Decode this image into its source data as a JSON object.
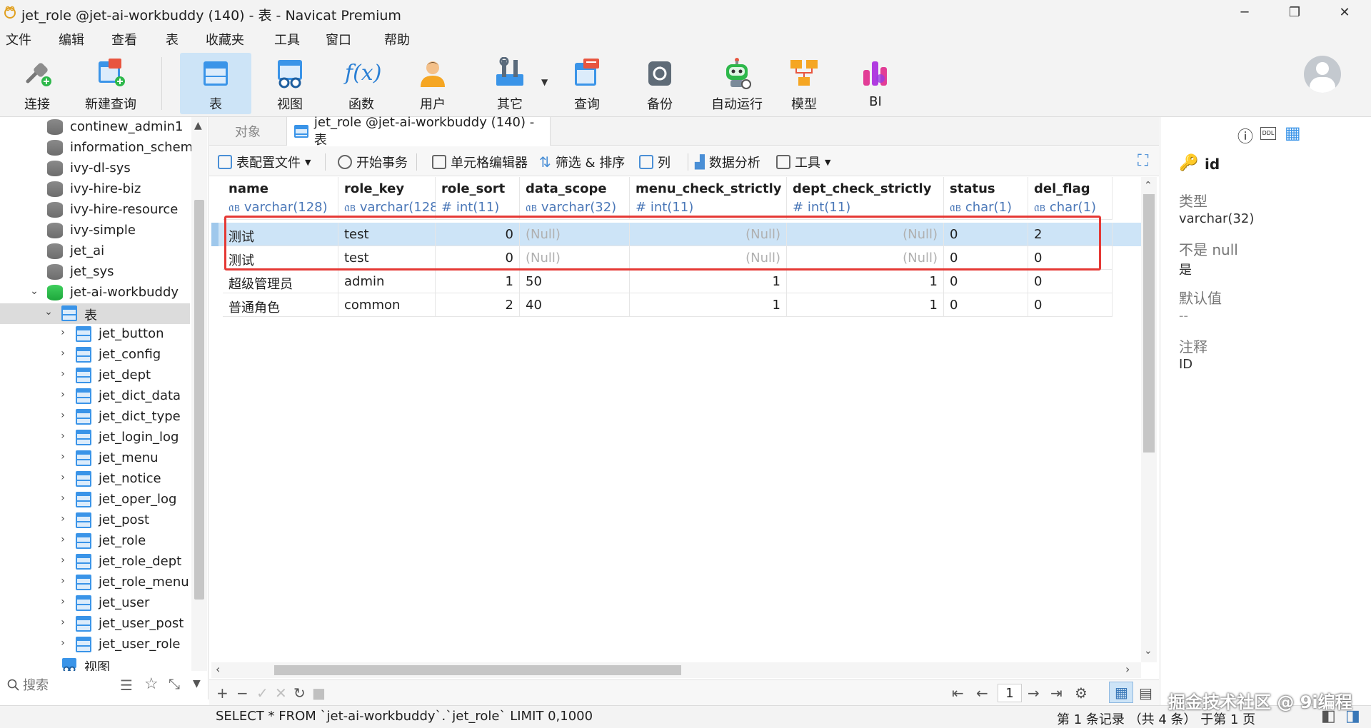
{
  "window": {
    "title": "jet_role @jet-ai-workbuddy (140) - 表 - Navicat Premium",
    "minimize": "─",
    "restore": "❐",
    "close": "✕"
  },
  "menu": [
    "文件",
    "编辑",
    "查看",
    "表",
    "收藏夹",
    "工具",
    "窗口",
    "帮助"
  ],
  "toolbar": {
    "connect": "连接",
    "new_query": "新建查询",
    "table": "表",
    "view": "视图",
    "function": "函数",
    "user": "用户",
    "other": "其它",
    "query": "查询",
    "backup": "备份",
    "automation": "自动运行",
    "model": "模型",
    "bi": "BI",
    "func_glyph": "f(x)"
  },
  "sidebar": {
    "databases": [
      "continew_admin1",
      "information_schema",
      "ivy-dl-sys",
      "ivy-hire-biz",
      "ivy-hire-resource",
      "ivy-simple",
      "jet_ai",
      "jet_sys",
      "jet-ai-workbuddy"
    ],
    "tables_node": "表",
    "tables": [
      "jet_button",
      "jet_config",
      "jet_dept",
      "jet_dict_data",
      "jet_dict_type",
      "jet_login_log",
      "jet_menu",
      "jet_notice",
      "jet_oper_log",
      "jet_post",
      "jet_role",
      "jet_role_dept",
      "jet_role_menu",
      "jet_user",
      "jet_user_post",
      "jet_user_role"
    ],
    "views_node": "视图",
    "search_placeholder": "搜索"
  },
  "tabs": {
    "objects": "对象",
    "current": "jet_role @jet-ai-workbuddy (140) - 表"
  },
  "inner_toolbar": {
    "table_profile": "表配置文件",
    "begin_transaction": "开始事务",
    "cell_editor": "单元格编辑器",
    "filter_sort": "筛选 & 排序",
    "columns": "列",
    "data_analysis": "数据分析",
    "tools": "工具"
  },
  "grid": {
    "columns": [
      {
        "name": "name",
        "type": "varchar(128)"
      },
      {
        "name": "role_key",
        "type": "varchar(128)"
      },
      {
        "name": "role_sort",
        "type": "int(11)"
      },
      {
        "name": "data_scope",
        "type": "varchar(32)"
      },
      {
        "name": "menu_check_strictly",
        "type": "int(11)"
      },
      {
        "name": "dept_check_strictly",
        "type": "int(11)"
      },
      {
        "name": "status",
        "type": "char(1)"
      },
      {
        "name": "del_flag",
        "type": "char(1)"
      }
    ],
    "rows": [
      [
        "测试",
        "test",
        "0",
        "(Null)",
        "(Null)",
        "(Null)",
        "0",
        "2"
      ],
      [
        "测试",
        "test",
        "0",
        "(Null)",
        "(Null)",
        "(Null)",
        "0",
        "0"
      ],
      [
        "超级管理员",
        "admin",
        "1",
        "50",
        "1",
        "1",
        "0",
        "0"
      ],
      [
        "普通角色",
        "common",
        "2",
        "40",
        "1",
        "1",
        "0",
        "0"
      ]
    ]
  },
  "navbar": {
    "page": "1"
  },
  "status": {
    "sql": "SELECT * FROM `jet-ai-workbuddy`.`jet_role` LIMIT 0,1000",
    "record_info": "第 1 条记录 （共 4 条） 于第 1 页"
  },
  "field_info": {
    "field": "id",
    "type_label": "类型",
    "type_value": "varchar(32)",
    "notnull_label": "不是 null",
    "notnull_value": "是",
    "default_label": "默认值",
    "default_value": "--",
    "comment_label": "注释",
    "comment_value": "ID"
  },
  "watermark": "掘金技术社区 @ 9i编程",
  "colors": {
    "accent": "#3a94e8",
    "selection": "#cde4f7",
    "highlight_box": "#e53935",
    "type_text": "#4b78b8"
  }
}
